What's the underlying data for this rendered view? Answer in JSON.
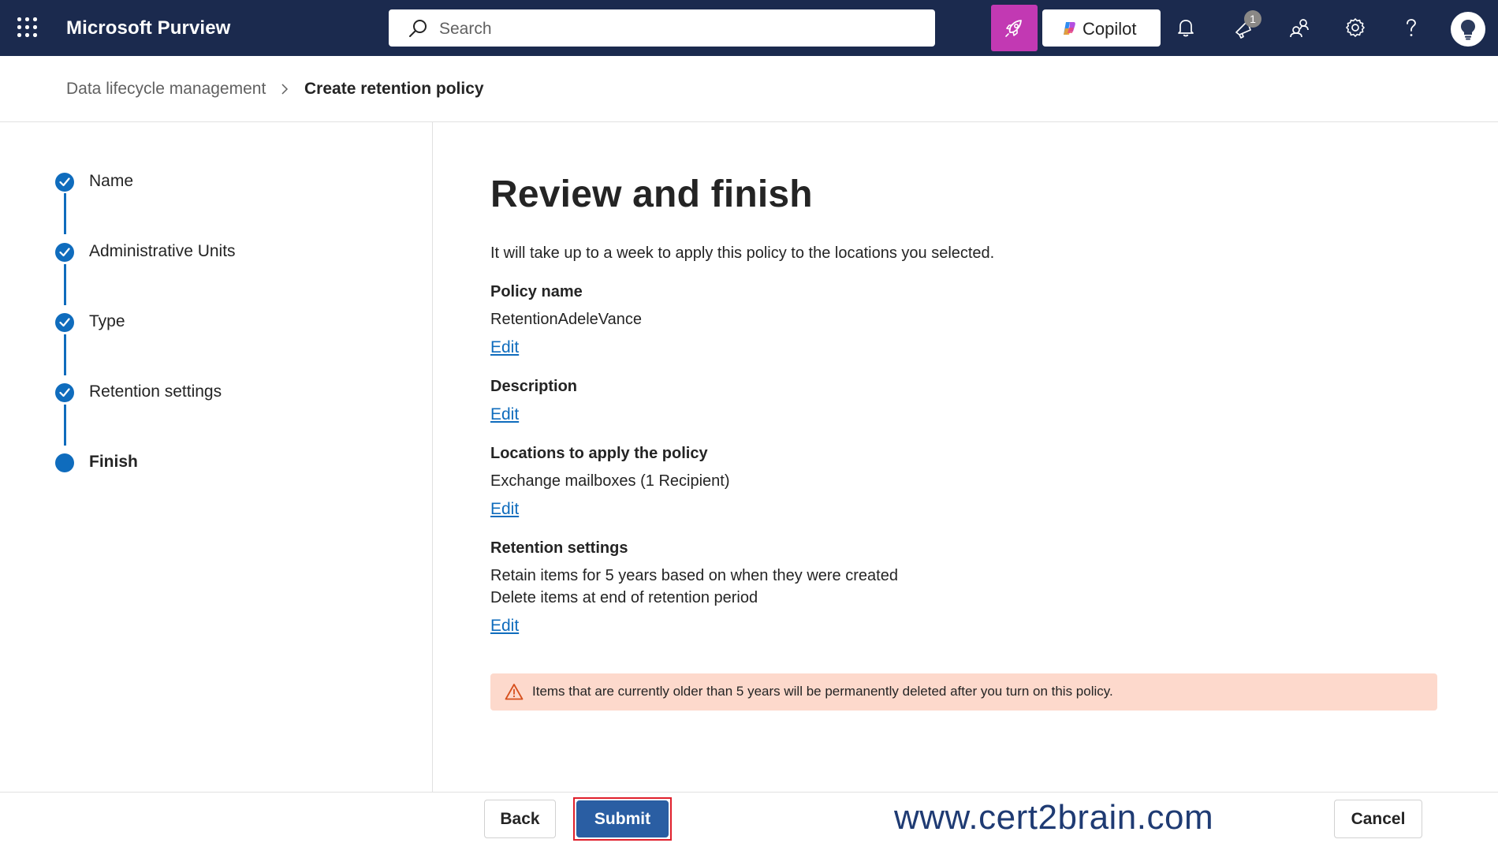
{
  "topbar": {
    "app_title": "Microsoft Purview",
    "search_placeholder": "Search",
    "copilot_label": "Copilot",
    "notification_badge": "1",
    "icons": [
      "waffle-icon",
      "search-icon",
      "rocket-icon",
      "copilot-icon",
      "bell-icon",
      "megaphone-icon",
      "community-icon",
      "gear-icon",
      "help-icon",
      "avatar-icon"
    ],
    "colors": {
      "bar": "#1b2a4e",
      "rocket": "#c239b3"
    }
  },
  "breadcrumb": {
    "parent": "Data lifecycle management",
    "current": "Create retention policy"
  },
  "steps": [
    {
      "label": "Name",
      "status": "complete"
    },
    {
      "label": "Administrative Units",
      "status": "complete"
    },
    {
      "label": "Type",
      "status": "complete"
    },
    {
      "label": "Retention settings",
      "status": "complete"
    },
    {
      "label": "Finish",
      "status": "current"
    }
  ],
  "main": {
    "title": "Review and finish",
    "intro": "It will take up to a week to apply this policy to the locations you selected.",
    "sections": {
      "policy_name": {
        "heading": "Policy name",
        "value": "RetentionAdeleVance",
        "edit": "Edit"
      },
      "description": {
        "heading": "Description",
        "edit": "Edit"
      },
      "locations": {
        "heading": "Locations to apply the policy",
        "value": "Exchange mailboxes (1 Recipient)",
        "edit": "Edit"
      },
      "retention": {
        "heading": "Retention settings",
        "line1": "Retain items for 5 years based on when they were created",
        "line2": "Delete items at end of retention period",
        "edit": "Edit"
      }
    },
    "warning": "Items that are currently older than 5 years will be permanently deleted after you turn on this policy."
  },
  "footer": {
    "back": "Back",
    "submit": "Submit",
    "cancel": "Cancel",
    "watermark": "www.cert2brain.com"
  },
  "colors": {
    "accent": "#0f6cbd",
    "submit": "#2a5ea3",
    "warning_bg": "#fdd9cc",
    "warning_icon": "#d64f1c"
  }
}
